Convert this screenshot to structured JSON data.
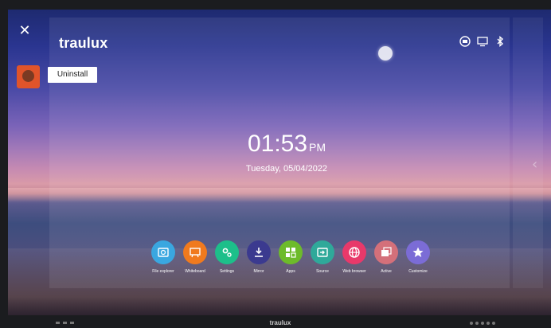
{
  "app": {
    "brand": "traulux",
    "bezel_brand": "traulux"
  },
  "overlay": {
    "close_icon": "close-icon",
    "uninstall_label": "Uninstall"
  },
  "clock": {
    "time": "01:53",
    "ampm": "PM",
    "date": "Tuesday, 05/04/2022"
  },
  "status_icons": [
    "screen-share-icon",
    "monitor-icon",
    "bluetooth-icon"
  ],
  "dock": [
    {
      "label": "File explorer",
      "icon": "folder-search-icon",
      "color": "#3aa7e0"
    },
    {
      "label": "Whiteboard",
      "icon": "whiteboard-icon",
      "color": "#f07a1e"
    },
    {
      "label": "Settings",
      "icon": "gear-icon",
      "color": "#1dbf8a"
    },
    {
      "label": "Mirror",
      "icon": "download-tray-icon",
      "color": "#3b3a8f"
    },
    {
      "label": "Apps",
      "icon": "apps-grid-icon",
      "color": "#6dbb2a"
    },
    {
      "label": "Source",
      "icon": "input-source-icon",
      "color": "#2fa99a"
    },
    {
      "label": "Web browser",
      "icon": "globe-icon",
      "color": "#e8396a"
    },
    {
      "label": "Active",
      "icon": "windows-icon",
      "color": "#d4707a"
    },
    {
      "label": "Customize",
      "icon": "star-icon",
      "color": "#7b6cd6"
    }
  ]
}
